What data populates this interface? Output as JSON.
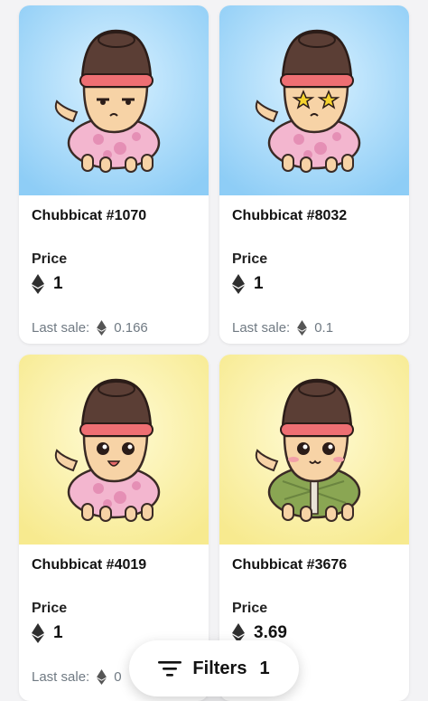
{
  "items": [
    {
      "name": "Chubbicat #1070",
      "price_label": "Price",
      "price": "1",
      "last_sale_label": "Last sale:",
      "last_sale": "0.166",
      "bg": "#a9d8f7",
      "outfit": "floral",
      "eyes": "squint"
    },
    {
      "name": "Chubbicat #8032",
      "price_label": "Price",
      "price": "1",
      "last_sale_label": "Last sale:",
      "last_sale": "0.1",
      "bg": "#a9d8f7",
      "outfit": "floral",
      "eyes": "stars"
    },
    {
      "name": "Chubbicat #4019",
      "price_label": "Price",
      "price": "1",
      "last_sale_label": "Last sale:",
      "last_sale": "0",
      "bg": "#fbf0a6",
      "outfit": "floral",
      "eyes": "happy"
    },
    {
      "name": "Chubbicat #3676",
      "price_label": "Price",
      "price": "3.69",
      "last_sale_label": "",
      "last_sale": "",
      "bg": "#fbf0a6",
      "outfit": "green-jacket",
      "eyes": "sparkle"
    }
  ],
  "filters": {
    "label": "Filters",
    "count": "1"
  },
  "colors": {
    "hat": "#5b3e35",
    "hat_band": "#ee6f73",
    "skin": "#f7d3a6",
    "floral": "#f3b6cf",
    "jacket": "#8aa653",
    "eth": "#2f2f2f"
  }
}
